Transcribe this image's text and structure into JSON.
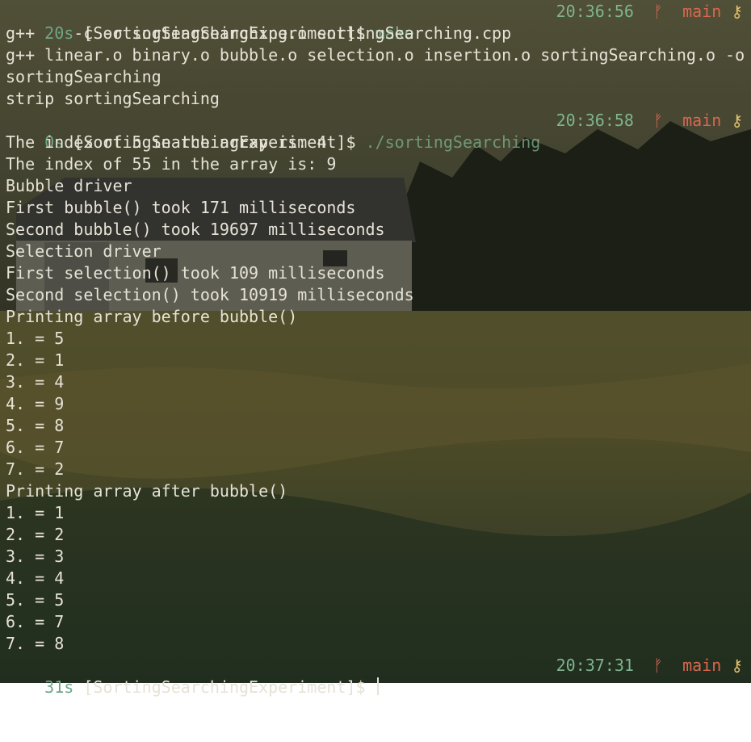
{
  "prompts": [
    {
      "duration": "20s",
      "dir": "[SortingSearchingExperiment]",
      "symbol": "$",
      "command": "make",
      "time": "20:36:56",
      "branch": "main"
    },
    {
      "duration": "0s",
      "dir": "[SortingSearchingExperiment]",
      "symbol": "$",
      "command": "./sortingSearching",
      "time": "20:36:58",
      "branch": "main"
    },
    {
      "duration": "31s",
      "dir": "[SortingSearchingExperiment]",
      "symbol": "$",
      "command": "",
      "time": "20:37:31",
      "branch": "main"
    }
  ],
  "make_output": [
    "g++    -c -o sortingSearching.o sortingSearching.cpp",
    "g++ linear.o binary.o bubble.o selection.o insertion.o sortingSearching.o -o",
    "sortingSearching",
    "strip sortingSearching"
  ],
  "program_output": [
    "The index of 5 in the array is: 4",
    "The index of 55 in the array is: 9",
    "Bubble driver",
    "First bubble() took 171 milliseconds",
    "Second bubble() took 19697 milliseconds",
    "Selection driver",
    "First selection() took 109 milliseconds",
    "Second selection() took 10919 milliseconds",
    "Printing array before bubble()",
    "1. = 5",
    "2. = 1",
    "3. = 4",
    "4. = 9",
    "5. = 8",
    "6. = 7",
    "7. = 2",
    "Printing array after bubble()",
    "1. = 1",
    "2. = 2",
    "3. = 3",
    "4. = 4",
    "5. = 5",
    "6. = 7",
    "7. = 8"
  ],
  "icons": {
    "branch": "git-branch-icon",
    "status": "key-icon"
  },
  "colors": {
    "prompt_green": "#7fb48e",
    "branch_red": "#d9684f",
    "key_yellow": "#e2c16a",
    "text": "#e6e2d6"
  }
}
